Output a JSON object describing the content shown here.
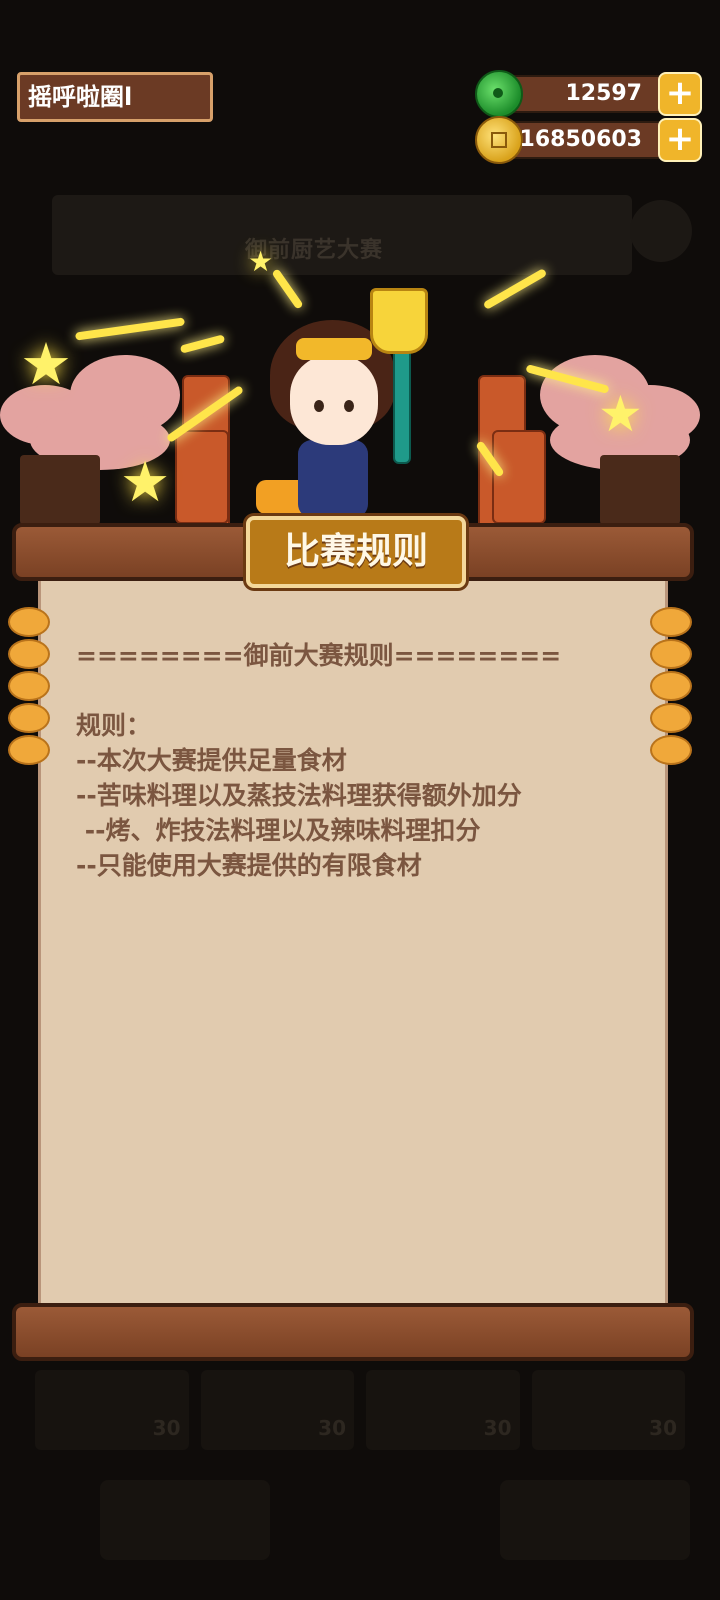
{
  "player": {
    "name": "摇呼啦圈l"
  },
  "resources": {
    "jade": {
      "value": "12597",
      "icon": "jade-coin-icon"
    },
    "gold": {
      "value": "16850603",
      "icon": "gold-coin-icon"
    },
    "plus_label": "+"
  },
  "background": {
    "banner_title": "御前厨艺大赛",
    "card_costs": [
      "30",
      "30",
      "30",
      "30"
    ]
  },
  "dialog": {
    "title": "比赛规则",
    "lines": [
      "========御前大赛规则========",
      "",
      "规则：",
      "--本次大赛提供足量食材",
      "--苦味料理以及蒸技法料理获得额外加分",
      " --烤、炸技法料理以及辣味料理扣分",
      "--只能使用大赛提供的有限食材"
    ]
  },
  "colors": {
    "paper": "#e1cbaf",
    "text": "#7b5640",
    "wood": "#7a4124",
    "gold_accent": "#f0b52a"
  }
}
